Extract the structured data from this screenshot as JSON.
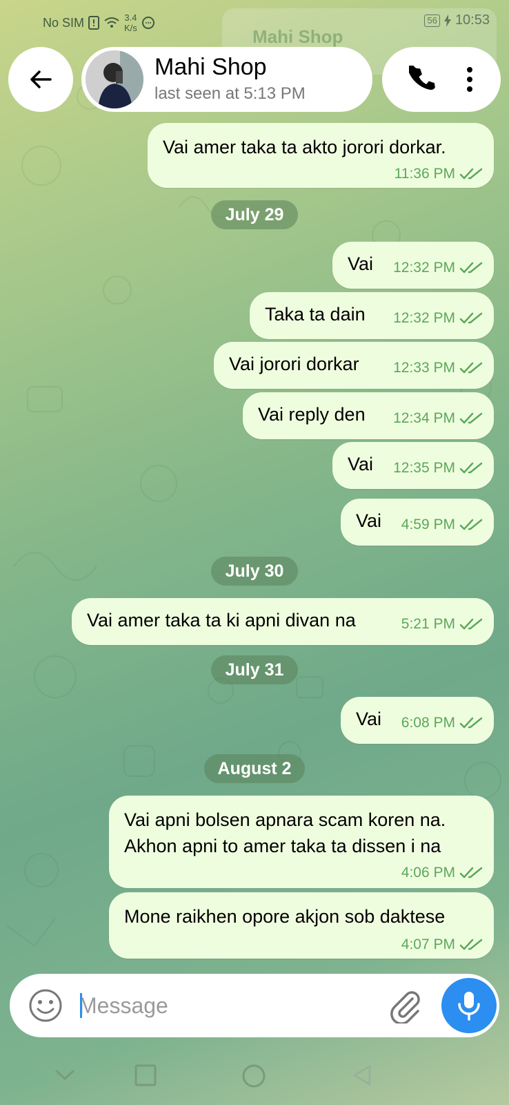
{
  "status_bar": {
    "carrier": "No SIM",
    "speed_value": "3.4",
    "speed_unit": "K/s",
    "battery": "56",
    "time": "10:53"
  },
  "header": {
    "contact_name": "Mahi Shop",
    "last_seen": "last seen at 5:13 PM",
    "ghost_name": "Mahi Shop"
  },
  "messages": [
    {
      "text": "Vai amer taka ta akto jorori dorkar.",
      "time": "11:36 PM"
    },
    {
      "text": "Vai",
      "time": "12:32 PM"
    },
    {
      "text": "Taka ta dain",
      "time": "12:32 PM"
    },
    {
      "text": "Vai jorori dorkar",
      "time": "12:33 PM"
    },
    {
      "text": "Vai reply den",
      "time": "12:34 PM"
    },
    {
      "text": "Vai",
      "time": "12:35 PM"
    },
    {
      "text": "Vai",
      "time": "4:59 PM"
    },
    {
      "text": "Vai amer taka ta ki apni divan na",
      "time": "5:21 PM"
    },
    {
      "text": "Vai",
      "time": "6:08 PM"
    },
    {
      "text_line1": "Vai apni bolsen apnara scam koren na.",
      "text_line2": "Akhon apni to amer taka ta dissen i na",
      "time": "4:06 PM"
    },
    {
      "text": "Mone raikhen opore akjon sob daktese",
      "time": "4:07 PM"
    }
  ],
  "dates": [
    "July 29",
    "July 30",
    "July 31",
    "August 2"
  ],
  "input": {
    "placeholder": "Message",
    "value": ""
  },
  "colors": {
    "accent": "#2b8ef0",
    "bubble": "#effddf",
    "tick": "#5aa85a"
  }
}
